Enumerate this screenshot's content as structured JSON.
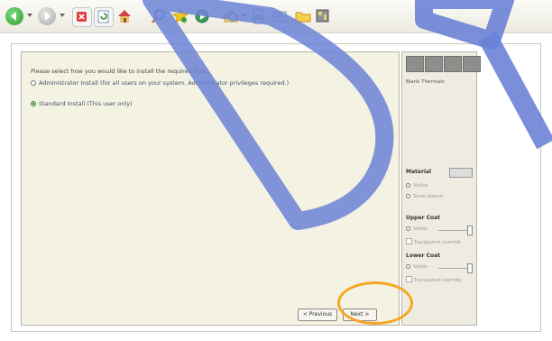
{
  "toolbar": {
    "icons": [
      "back-icon",
      "forward-icon",
      "stop-icon",
      "refresh-icon",
      "home-icon",
      "search-icon",
      "favorites-icon",
      "media-icon",
      "history-icon",
      "print-icon",
      "edit-icon",
      "folder-icon",
      "discuss-icon"
    ]
  },
  "dialog": {
    "prompt": "Please select how you would like to install the required files:",
    "options": [
      {
        "label": "Administrator Install (for all users on your system. Administrator privileges required.)",
        "selected": false
      },
      {
        "label": "Standard Install (This user only)",
        "selected": true
      }
    ],
    "previous_label": "< Previous",
    "next_label": "Next >"
  },
  "side": {
    "caption": "Blank Thermals",
    "material_label": "Material",
    "material_options": [
      "Visible",
      "Show texture"
    ],
    "upper_coat_label": "Upper Coat",
    "upper_visible": "Visible",
    "upper_transparent": "Transparent override",
    "lower_coat_label": "Lower Coat",
    "lower_visible": "Visible",
    "lower_transparent": "Transparent override"
  },
  "watermark": {
    "text": "DR"
  },
  "colors": {
    "watermark": "#6b82d6",
    "ring": "#f5a623",
    "accent": "#3b8a3b"
  }
}
